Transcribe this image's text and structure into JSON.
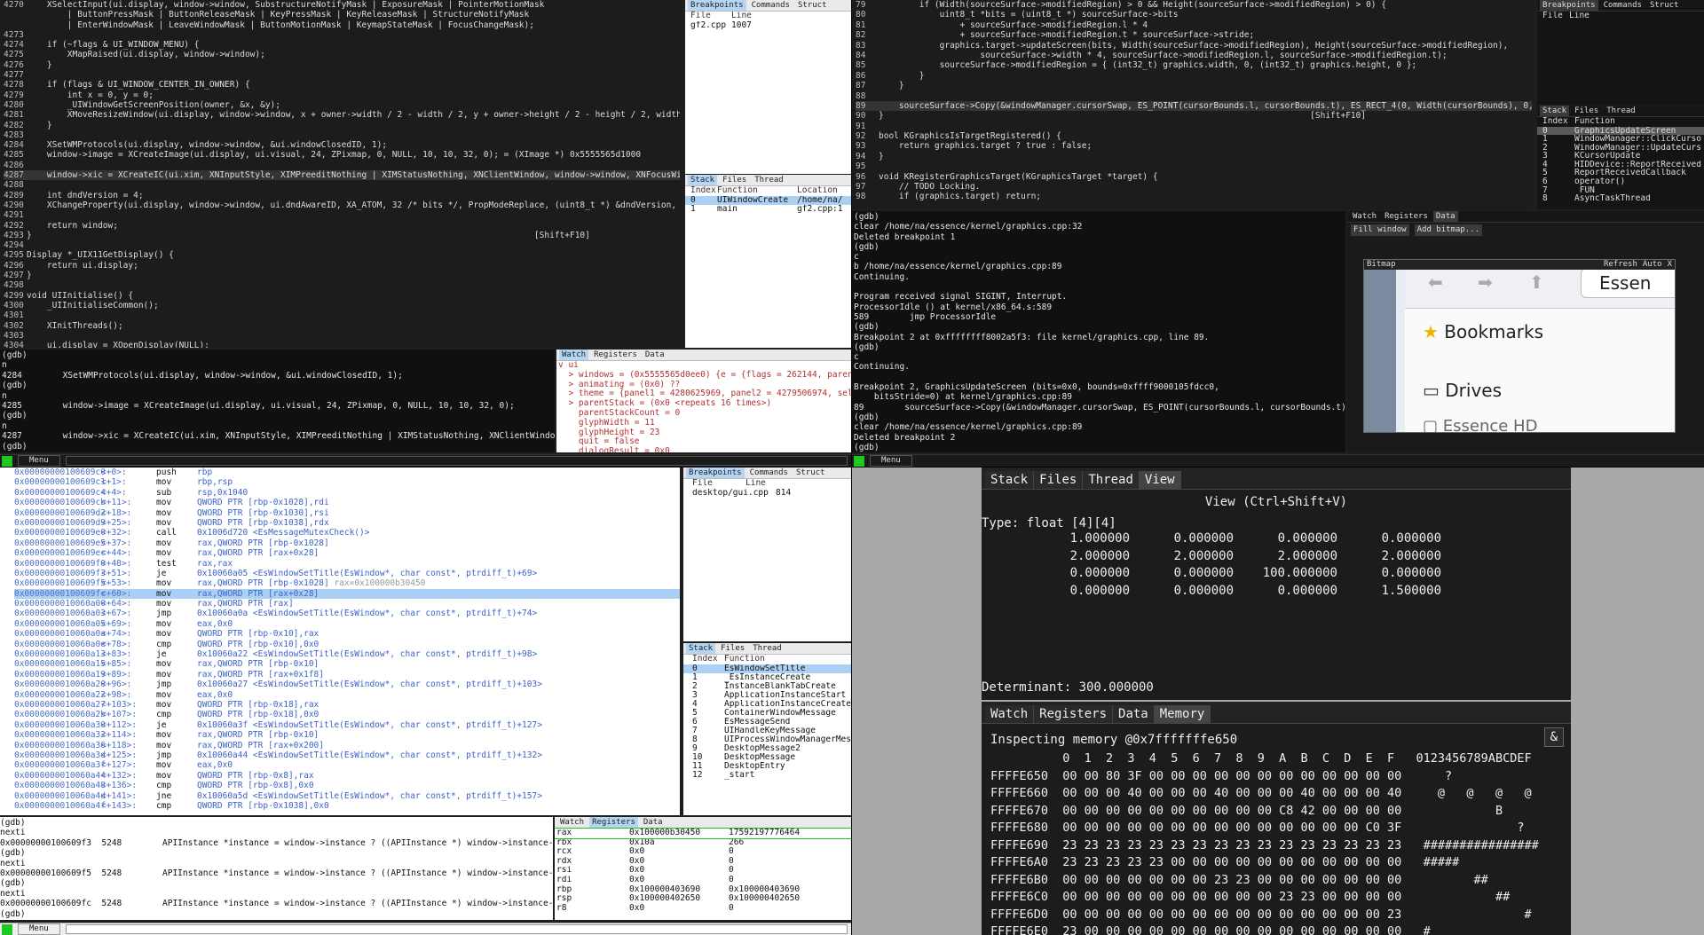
{
  "q1": {
    "code_lines": [
      {
        "no": "4270",
        "t": "    XSelectInput(ui.display, window->window, SubstructureNotifyMask | ExposureMask | PointerMotionMask"
      },
      {
        "no": "",
        "t": "        | ButtonPressMask | ButtonReleaseMask | KeyPressMask | KeyReleaseMask | StructureNotifyMask"
      },
      {
        "no": "",
        "t": "        | EnterWindowMask | LeaveWindowMask | ButtonMotionMask | KeymapStateMask | FocusChangeMask);"
      },
      {
        "no": "4273",
        "t": ""
      },
      {
        "no": "4274",
        "t": "    if (~flags & UI_WINDOW_MENU) {"
      },
      {
        "no": "4275",
        "t": "        XMapRaised(ui.display, window->window);"
      },
      {
        "no": "4276",
        "t": "    }"
      },
      {
        "no": "4277",
        "t": ""
      },
      {
        "no": "4278",
        "t": "    if (flags & UI_WINDOW_CENTER_IN_OWNER) {"
      },
      {
        "no": "4279",
        "t": "        int x = 0, y = 0;"
      },
      {
        "no": "4280",
        "t": "        _UIWindowGetScreenPosition(owner, &x, &y);"
      },
      {
        "no": "4281",
        "t": "        XMoveResizeWindow(ui.display, window->window, x + owner->width / 2 - width / 2, y + owner->height / 2 - height / 2, width, h"
      },
      {
        "no": "4282",
        "t": "    }"
      },
      {
        "no": "4283",
        "t": ""
      },
      {
        "no": "4284",
        "t": "    XSetWMProtocols(ui.display, window->window, &ui.windowClosedID, 1);"
      },
      {
        "no": "4285",
        "t": "    window->image = XCreateImage(ui.display, ui.visual, 24, ZPixmap, 0, NULL, 10, 10, 32, 0); = (XImage *) 0x5555565d1000"
      },
      {
        "no": "4286",
        "t": ""
      },
      {
        "no": "4287",
        "t": "    window->xic = XCreateIC(ui.xim, XNInputStyle, XIMPreeditNothing | XIMStatusNothing, XNClientWindow, window->window, XNFocusWind"
      },
      {
        "no": "4288",
        "t": ""
      },
      {
        "no": "4289",
        "t": "    int dndVersion = 4;"
      },
      {
        "no": "4290",
        "t": "    XChangeProperty(ui.display, window->window, ui.dndAwareID, XA_ATOM, 32 /* bits */, PropModeReplace, (uint8_t *) &dndVersion, 1);"
      },
      {
        "no": "4291",
        "t": ""
      },
      {
        "no": "4292",
        "t": "    return window;"
      },
      {
        "no": "4293",
        "t": "}                                                                                                   [Shift+F10]"
      },
      {
        "no": "4294",
        "t": ""
      },
      {
        "no": "4295",
        "t": "Display *_UIX11GetDisplay() {"
      },
      {
        "no": "4296",
        "t": "    return ui.display;"
      },
      {
        "no": "4297",
        "t": "}"
      },
      {
        "no": "4298",
        "t": ""
      },
      {
        "no": "4299",
        "t": "void UIInitialise() {"
      },
      {
        "no": "4300",
        "t": "    _UIInitialiseCommon();"
      },
      {
        "no": "4301",
        "t": ""
      },
      {
        "no": "4302",
        "t": "    XInitThreads();"
      },
      {
        "no": "4303",
        "t": ""
      },
      {
        "no": "4304",
        "t": "    ui.display = XOpenDisplay(NULL);"
      }
    ],
    "bp_tabs": [
      "Breakpoints",
      "Commands",
      "Struct"
    ],
    "bp_headers": [
      "File",
      "Line"
    ],
    "bp_rows": [
      [
        "gf2.cpp",
        "1007"
      ]
    ],
    "stack_tabs": [
      "Stack",
      "Files",
      "Thread"
    ],
    "stack_headers": [
      "Index",
      "Function",
      "Location"
    ],
    "stack_rows": [
      [
        "0",
        "UIWindowCreate",
        "/home/na/"
      ],
      [
        "1",
        "main",
        "gf2.cpp:1"
      ]
    ],
    "console_lines": [
      "(gdb)",
      "n",
      "4284        XSetWMProtocols(ui.display, window->window, &ui.windowClosedID, 1);",
      "(gdb)",
      "n",
      "4285        window->image = XCreateImage(ui.display, ui.visual, 24, ZPixmap, 0, NULL, 10, 10, 32, 0);",
      "(gdb)",
      "n",
      "4287        window->xic = XCreateIC(ui.xim, XNInputStyle, XIMPreeditNothing | XIMStatusNothing, XNClientWindow,",
      "(gdb)"
    ],
    "watch_tabs": [
      "Watch",
      "Registers",
      "Data"
    ],
    "watch_lines": [
      "v ui",
      "  > windows = (0x5555565d0ee0) {e = {flags = 262144, paren",
      "  > animating = (0x0) ??",
      "  > theme = {panel1 = 4280625969, panel2 = 4279506974, sel",
      "  > parentStack = (0x0 <repeats 16 times>)",
      "    parentStackCount = 0",
      "    glyphWidth = 11",
      "    glyphHeight = 23",
      "    quit = false",
      "    dialogResult = 0x0"
    ],
    "menu_label": "Menu"
  },
  "q2": {
    "code_lines": [
      {
        "no": "79",
        "t": "        if (Width(sourceSurface->modifiedRegion) > 0 && Height(sourceSurface->modifiedRegion) > 0) {"
      },
      {
        "no": "80",
        "t": "            uint8_t *bits = (uint8_t *) sourceSurface->bits"
      },
      {
        "no": "81",
        "t": "                + sourceSurface->modifiedRegion.l * 4"
      },
      {
        "no": "82",
        "t": "                + sourceSurface->modifiedRegion.t * sourceSurface->stride;"
      },
      {
        "no": "83",
        "t": "            graphics.target->updateScreen(bits, Width(sourceSurface->modifiedRegion), Height(sourceSurface->modifiedRegion),"
      },
      {
        "no": "84",
        "t": "                    sourceSurface->width * 4, sourceSurface->modifiedRegion.l, sourceSurface->modifiedRegion.t);"
      },
      {
        "no": "85",
        "t": "            sourceSurface->modifiedRegion = { (int32_t) graphics.width, 0, (int32_t) graphics.height, 0 };"
      },
      {
        "no": "86",
        "t": "        }"
      },
      {
        "no": "87",
        "t": "    }"
      },
      {
        "no": "88",
        "t": ""
      },
      {
        "no": "89",
        "t": "    sourceSurface->Copy(&windowManager.cursorSwap, ES_POINT(cursorBounds.l, cursorBounds.t), ES_RECT_4(0, Width(cursorBounds), 0, He"
      },
      {
        "no": "90",
        "t": "}                                                                                    [Shift+F10]"
      },
      {
        "no": "91",
        "t": ""
      },
      {
        "no": "92",
        "t": "bool KGraphicsIsTargetRegistered() {"
      },
      {
        "no": "93",
        "t": "    return graphics.target ? true : false;"
      },
      {
        "no": "94",
        "t": "}"
      },
      {
        "no": "95",
        "t": ""
      },
      {
        "no": "96",
        "t": "void KRegisterGraphicsTarget(KGraphicsTarget *target) {"
      },
      {
        "no": "97",
        "t": "    // TODO Locking."
      },
      {
        "no": "98",
        "t": "    if (graphics.target) return;"
      }
    ],
    "bp_tabs": [
      "Breakpoints",
      "Commands",
      "Struct"
    ],
    "bp_headers": [
      "File",
      "Line"
    ],
    "stack_tabs": [
      "Stack",
      "Files",
      "Thread"
    ],
    "stack_headers": [
      "Index",
      "Function"
    ],
    "stack_rows": [
      [
        "0",
        "GraphicsUpdateScreen"
      ],
      [
        "1",
        "WindowManager::ClickCurso"
      ],
      [
        "2",
        "WindowManager::UpdateCurs"
      ],
      [
        "3",
        "KCursorUpdate"
      ],
      [
        "4",
        "HIDDevice::ReportReceived"
      ],
      [
        "5",
        "ReportReceivedCallback"
      ],
      [
        "6",
        "operator()"
      ],
      [
        "7",
        "_FUN"
      ],
      [
        "8",
        "AsyncTaskThread"
      ]
    ],
    "console_lines": [
      "(gdb)",
      "clear /home/na/essence/kernel/graphics.cpp:32",
      "Deleted breakpoint 1",
      "(gdb)",
      "c",
      "b /home/na/essence/kernel/graphics.cpp:89",
      "Continuing.",
      "",
      "Program received signal SIGINT, Interrupt.",
      "ProcessorIdle () at kernel/x86_64.s:589",
      "589        jmp ProcessorIdle",
      "(gdb)",
      "Breakpoint 2 at 0xffffffff8002a5f3: file kernel/graphics.cpp, line 89.",
      "(gdb)",
      "c",
      "Continuing.",
      "",
      "Breakpoint 2, GraphicsUpdateScreen (bits=0x0, bounds=0xffff9000105fdcc0,",
      "    bitsStride=0) at kernel/graphics.cpp:89",
      "89        sourceSurface->Copy(&windowManager.cursorSwap, ES_POINT(cursorBounds.l, cursorBounds.t), ES_",
      "(gdb)",
      "clear /home/na/essence/kernel/graphics.cpp:89",
      "Deleted breakpoint 2",
      "(gdb)"
    ],
    "watch_tabs": [
      "Watch",
      "Registers",
      "Data"
    ],
    "data_buttons": [
      "Fill window",
      "Add bitmap..."
    ],
    "bitmap_title": "Bitmap",
    "bitmap_buttons": [
      "Refresh",
      "Auto",
      "X"
    ],
    "bitmap_content": {
      "header": "Essen",
      "items": [
        "Bookmarks",
        "Drives",
        "Essence HD"
      ]
    },
    "menu_label": "Menu"
  },
  "q3": {
    "asm_lines": [
      {
        "a": "0x00000000100609c0",
        "o": "<+0>:",
        "i": "push",
        "r": "rbp",
        "c": ""
      },
      {
        "a": "0x00000000100609c1",
        "o": "<+1>:",
        "i": "mov",
        "r": "rbp,rsp",
        "c": ""
      },
      {
        "a": "0x00000000100609c4",
        "o": "<+4>:",
        "i": "sub",
        "r": "rsp,0x1040",
        "c": ""
      },
      {
        "a": "0x00000000100609cb",
        "o": "<+11>:",
        "i": "mov",
        "r": "QWORD PTR [rbp-0x1028],rdi",
        "c": ""
      },
      {
        "a": "0x00000000100609d2",
        "o": "<+18>:",
        "i": "mov",
        "r": "QWORD PTR [rbp-0x1030],rsi",
        "c": ""
      },
      {
        "a": "0x00000000100609d9",
        "o": "<+25>:",
        "i": "mov",
        "r": "QWORD PTR [rbp-0x1038],rdx",
        "c": ""
      },
      {
        "a": "0x00000000100609e0",
        "o": "<+32>:",
        "i": "call",
        "r": "0x1006d720 <EsMessageMutexCheck()>",
        "c": ""
      },
      {
        "a": "0x00000000100609e5",
        "o": "<+37>:",
        "i": "mov",
        "r": "rax,QWORD PTR [rbp-0x1028]",
        "c": ""
      },
      {
        "a": "0x00000000100609ec",
        "o": "<+44>:",
        "i": "mov",
        "r": "rax,QWORD PTR [rax+0x28]",
        "c": ""
      },
      {
        "a": "0x00000000100609f0",
        "o": "<+48>:",
        "i": "test",
        "r": "rax,rax",
        "c": ""
      },
      {
        "a": "0x00000000100609f3",
        "o": "<+51>:",
        "i": "je",
        "r": "0x10060a05 <EsWindowSetTitle(EsWindow*, char const*, ptrdiff_t)+69>",
        "c": ""
      },
      {
        "a": "0x00000000100609f5",
        "o": "<+53>:",
        "i": "mov",
        "r": "rax,QWORD PTR [rbp-0x1028]",
        "c": " rax=0x100000b30450"
      },
      {
        "a": "0x00000000100609fc",
        "o": "<+60>:",
        "i": "mov",
        "r": "rax,QWORD PTR [rax+0x28]",
        "c": ""
      },
      {
        "a": "0x0000000010060a00",
        "o": "<+64>:",
        "i": "mov",
        "r": "rax,QWORD PTR [rax]",
        "c": ""
      },
      {
        "a": "0x0000000010060a03",
        "o": "<+67>:",
        "i": "jmp",
        "r": "0x10060a0a <EsWindowSetTitle(EsWindow*, char const*, ptrdiff_t)+74>",
        "c": ""
      },
      {
        "a": "0x0000000010060a05",
        "o": "<+69>:",
        "i": "mov",
        "r": "eax,0x0",
        "c": ""
      },
      {
        "a": "0x0000000010060a0a",
        "o": "<+74>:",
        "i": "mov",
        "r": "QWORD PTR [rbp-0x10],rax",
        "c": ""
      },
      {
        "a": "0x0000000010060a0e",
        "o": "<+78>:",
        "i": "cmp",
        "r": "QWORD PTR [rbp-0x10],0x0",
        "c": ""
      },
      {
        "a": "0x0000000010060a13",
        "o": "<+83>:",
        "i": "je",
        "r": "0x10060a22 <EsWindowSetTitle(EsWindow*, char const*, ptrdiff_t)+98>",
        "c": ""
      },
      {
        "a": "0x0000000010060a15",
        "o": "<+85>:",
        "i": "mov",
        "r": "rax,QWORD PTR [rbp-0x10]",
        "c": ""
      },
      {
        "a": "0x0000000010060a19",
        "o": "<+89>:",
        "i": "mov",
        "r": "rax,QWORD PTR [rax+0x1f8]",
        "c": ""
      },
      {
        "a": "0x0000000010060a20",
        "o": "<+96>:",
        "i": "jmp",
        "r": "0x10060a27 <EsWindowSetTitle(EsWindow*, char const*, ptrdiff_t)+103>",
        "c": ""
      },
      {
        "a": "0x0000000010060a22",
        "o": "<+98>:",
        "i": "mov",
        "r": "eax,0x0",
        "c": ""
      },
      {
        "a": "0x0000000010060a27",
        "o": "<+103>:",
        "i": "mov",
        "r": "QWORD PTR [rbp-0x18],rax",
        "c": ""
      },
      {
        "a": "0x0000000010060a2b",
        "o": "<+107>:",
        "i": "cmp",
        "r": "QWORD PTR [rbp-0x18],0x0",
        "c": ""
      },
      {
        "a": "0x0000000010060a30",
        "o": "<+112>:",
        "i": "je",
        "r": "0x10060a3f <EsWindowSetTitle(EsWindow*, char const*, ptrdiff_t)+127>",
        "c": ""
      },
      {
        "a": "0x0000000010060a32",
        "o": "<+114>:",
        "i": "mov",
        "r": "rax,QWORD PTR [rbp-0x10]",
        "c": ""
      },
      {
        "a": "0x0000000010060a36",
        "o": "<+118>:",
        "i": "mov",
        "r": "rax,QWORD PTR [rax+0x200]",
        "c": ""
      },
      {
        "a": "0x0000000010060a3d",
        "o": "<+125>:",
        "i": "jmp",
        "r": "0x10060a44 <EsWindowSetTitle(EsWindow*, char const*, ptrdiff_t)+132>",
        "c": ""
      },
      {
        "a": "0x0000000010060a3f",
        "o": "<+127>:",
        "i": "mov",
        "r": "eax,0x0",
        "c": ""
      },
      {
        "a": "0x0000000010060a44",
        "o": "<+132>:",
        "i": "mov",
        "r": "QWORD PTR [rbp-0x8],rax",
        "c": ""
      },
      {
        "a": "0x0000000010060a48",
        "o": "<+136>:",
        "i": "cmp",
        "r": "QWORD PTR [rbp-0x8],0x0",
        "c": ""
      },
      {
        "a": "0x0000000010060a4d",
        "o": "<+141>:",
        "i": "jne",
        "r": "0x10060a5d <EsWindowSetTitle(EsWindow*, char const*, ptrdiff_t)+157>",
        "c": ""
      },
      {
        "a": "0x0000000010060a4f",
        "o": "<+143>:",
        "i": "cmp",
        "r": "QWORD PTR [rbp-0x1038],0x0",
        "c": ""
      }
    ],
    "bp_tabs": [
      "Breakpoints",
      "Commands",
      "Struct"
    ],
    "bp_headers": [
      "File",
      "Line"
    ],
    "bp_rows": [
      [
        "desktop/gui.cpp",
        "814"
      ]
    ],
    "stack_tabs": [
      "Stack",
      "Files",
      "Thread"
    ],
    "stack_headers": [
      "Index",
      "Function"
    ],
    "stack_rows": [
      [
        "0",
        "EsWindowSetTitle"
      ],
      [
        "1",
        "_EsInstanceCreate"
      ],
      [
        "2",
        "InstanceBlankTabCreate"
      ],
      [
        "3",
        "ApplicationInstanceStart"
      ],
      [
        "4",
        "ApplicationInstanceCreate"
      ],
      [
        "5",
        "ContainerWindowMessage"
      ],
      [
        "6",
        "EsMessageSend"
      ],
      [
        "7",
        "UIHandleKeyMessage"
      ],
      [
        "8",
        "UIProcessWindowManagerMes"
      ],
      [
        "9",
        "DesktopMessage2"
      ],
      [
        "10",
        "DesktopMessage"
      ],
      [
        "11",
        "DesktopEntry"
      ],
      [
        "12",
        "_start"
      ]
    ],
    "console_lines": [
      "(gdb)",
      "nexti",
      "0x00000000100609f3  5248        APIInstance *instance = window->instance ? ((APIInstance *) window->instance->_p",
      "(gdb)",
      "nexti",
      "0x00000000100609f5  5248        APIInstance *instance = window->instance ? ((APIInstance *) window->instance->_p",
      "(gdb)",
      "nexti",
      "0x00000000100609fc  5248        APIInstance *instance = window->instance ? ((APIInstance *) window->instance->_p",
      "(gdb)"
    ],
    "watch_tabs": [
      "Watch",
      "Registers",
      "Data"
    ],
    "registers": [
      [
        "rax",
        "0x100000b30450",
        "17592197776464"
      ],
      [
        "rbx",
        "0x10a",
        "266"
      ],
      [
        "rcx",
        "0x0",
        "0"
      ],
      [
        "rdx",
        "0x0",
        "0"
      ],
      [
        "rsi",
        "0x0",
        "0"
      ],
      [
        "rdi",
        "0x0",
        "0"
      ],
      [
        "rbp",
        "0x100000403690",
        "0x100000403690"
      ],
      [
        "rsp",
        "0x100000402650",
        "0x100000402650"
      ],
      [
        "r8",
        "0x0",
        "0"
      ]
    ],
    "menu_label": "Menu"
  },
  "q4": {
    "top_tabs": [
      "Stack",
      "Files",
      "Thread",
      "View"
    ],
    "view_title": "View (Ctrl+Shift+V)",
    "type_line": "Type: float [4][4]",
    "matrix": [
      [
        "1.000000",
        "0.000000",
        "0.000000",
        "0.000000"
      ],
      [
        "2.000000",
        "2.000000",
        "2.000000",
        "2.000000"
      ],
      [
        "0.000000",
        "0.000000",
        "100.000000",
        "0.000000"
      ],
      [
        "0.000000",
        "0.000000",
        "0.000000",
        "1.500000"
      ]
    ],
    "determinant_line": "Determinant: 300.000000",
    "bottom_tabs": [
      "Watch",
      "Registers",
      "Data",
      "Memory"
    ],
    "inspect_line": "Inspecting memory @0x7fffffffe650",
    "amp_button": "&",
    "hex_header": "          0  1  2  3  4  5  6  7  8  9  A  B  C  D  E  F   0123456789ABCDEF",
    "hex_rows": [
      "FFFFE650  00 00 80 3F 00 00 00 00 00 00 00 00 00 00 00 00      ?",
      "FFFFE660  00 00 00 40 00 00 00 40 00 00 00 40 00 00 00 40     @   @   @   @",
      "FFFFE670  00 00 00 00 00 00 00 00 00 00 C8 42 00 00 00 00             B",
      "FFFFE680  00 00 00 00 00 00 00 00 00 00 00 00 00 00 C0 3F                ?",
      "FFFFE690  23 23 23 23 23 23 23 23 23 23 23 23 23 23 23 23   ################",
      "FFFFE6A0  23 23 23 23 23 00 00 00 00 00 00 00 00 00 00 00   #####",
      "FFFFE6B0  00 00 00 00 00 00 00 23 23 00 00 00 00 00 00 00          ##",
      "FFFFE6C0  00 00 00 00 00 00 00 00 00 00 23 23 00 00 00 00             ##",
      "FFFFE6D0  00 00 00 00 00 00 00 00 00 00 00 00 00 00 00 23                 #",
      "FFFFE6E0  23 00 00 00 00 00 00 00 00 00 00 00 00 00 00 00   #"
    ]
  }
}
